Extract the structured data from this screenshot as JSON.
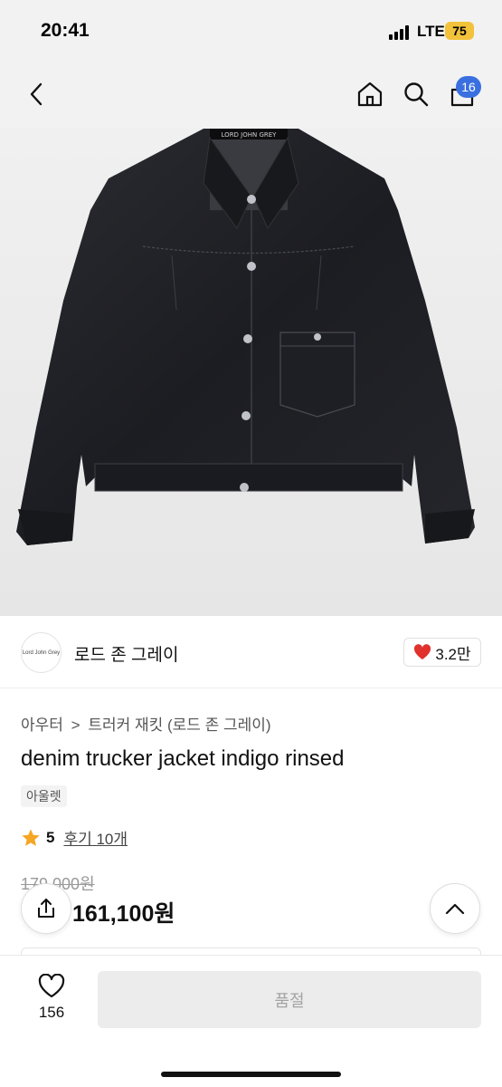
{
  "status_bar": {
    "time": "20:41",
    "network": "LTE",
    "battery": "75"
  },
  "nav": {
    "cart_count": "16"
  },
  "product_image": {
    "brand_label": "LORD JOHN GREY"
  },
  "seller": {
    "name": "로드 존 그레이",
    "logo_text": "Lord John Grey",
    "likes": "3.2만"
  },
  "breadcrumb": {
    "category": "아우터",
    "separator": ">",
    "subcategory": "트러커 재킷 (로드 존 그레이)"
  },
  "product": {
    "title": "denim trucker jacket indigo rinsed",
    "tag": "아울렛",
    "rating": "5",
    "reviews": "후기 10개",
    "original_price": "179,000원",
    "sale_price": "161,100원"
  },
  "bottom_bar": {
    "wish_count": "156",
    "buy_label": "품절"
  },
  "colors": {
    "accent_blue": "#3a6fe0",
    "heart_red": "#e0312d",
    "star_orange": "#f5a623",
    "battery_yellow": "#f2c23a"
  }
}
